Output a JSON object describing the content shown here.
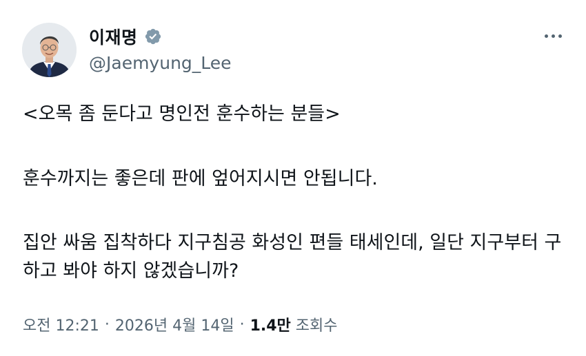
{
  "author": {
    "display_name": "이재명",
    "handle": "@Jaemyung_Lee",
    "verified": true,
    "avatar_icon": "profile-photo"
  },
  "tweet": {
    "paragraphs": [
      "<오목 좀 둔다고 명인전 훈수하는 분들>",
      "훈수까지는 좋은데 판에 엎어지시면 안됩니다.",
      "집안 싸움 집착하다 지구침공 화성인 편들 태세인데, 일단 지구부터 구하고 봐야 하지 않겠습니까?"
    ]
  },
  "meta": {
    "time": "오전 12:21",
    "separator": "·",
    "date": "2026년 4월 14일",
    "views_count": "1.4만",
    "views_label": "조회수"
  },
  "icons": {
    "verified": "verified-badge-icon",
    "more": "more-options-icon"
  },
  "colors": {
    "text": "#0f1419",
    "secondary": "#536471",
    "verified_badge": "#829aab"
  }
}
